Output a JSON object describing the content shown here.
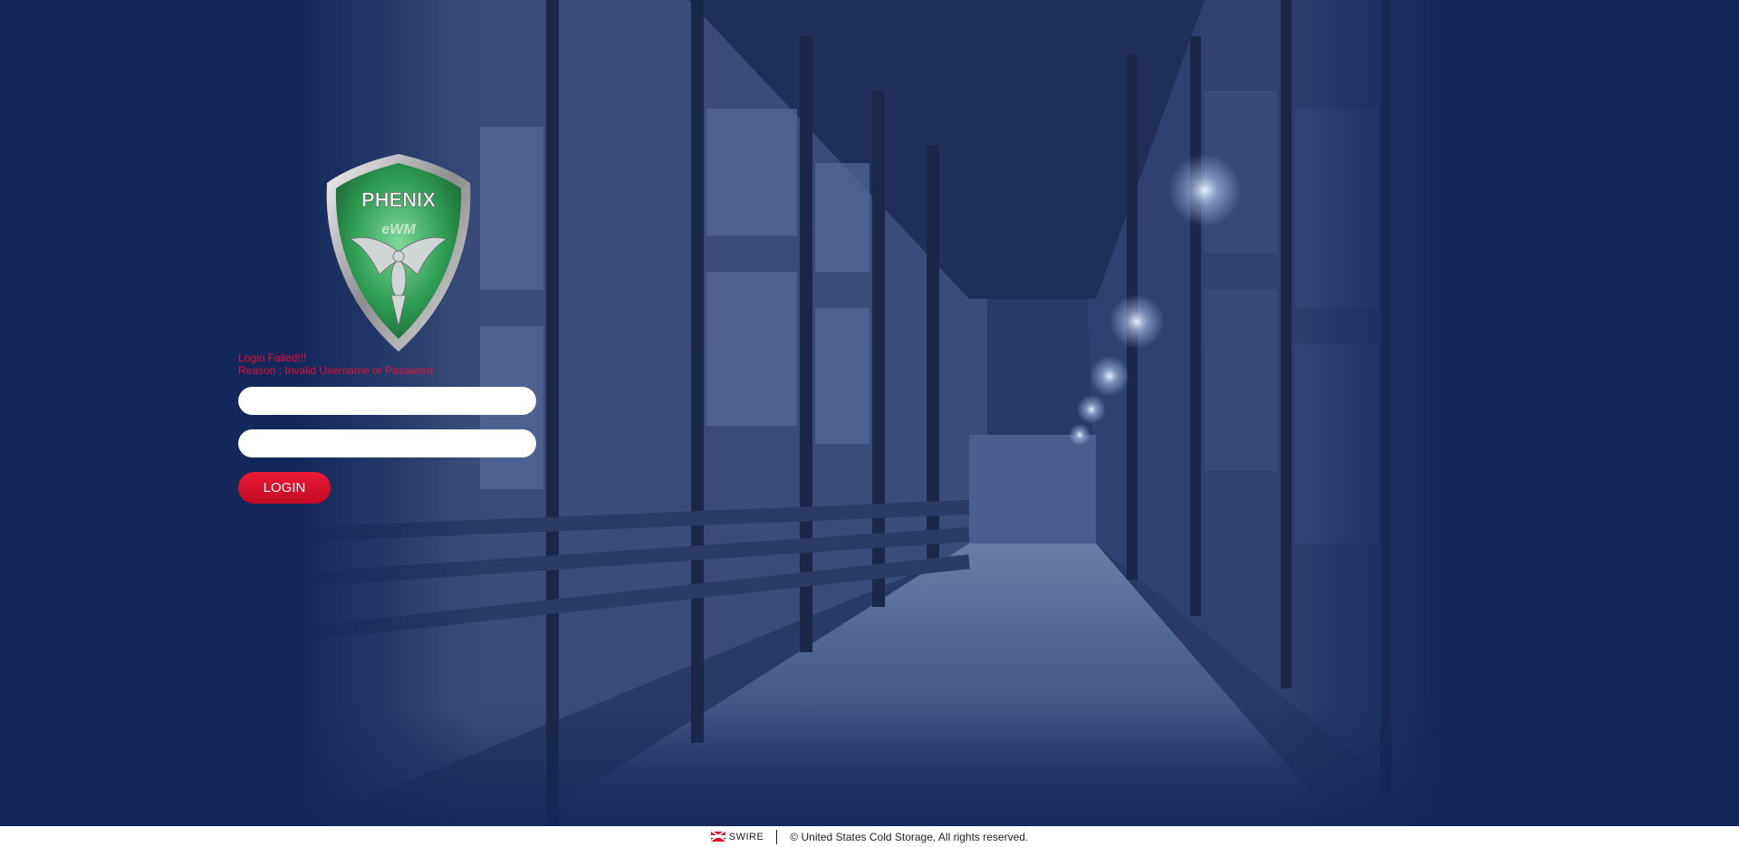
{
  "logo": {
    "brand": "PHENIX",
    "product": "eWM"
  },
  "login": {
    "error_title": "Login Failed!!!",
    "error_reason": "Reason : Invalid Username or Password",
    "username_value": "",
    "password_value": "",
    "button_label": "LOGIN"
  },
  "footer": {
    "brand": "SWIRE",
    "copyright": "© United States Cold Storage, All rights reserved."
  },
  "colors": {
    "background": "#13275a",
    "error_text": "#e8103a",
    "button": "#d8102b",
    "logo_green": "#2f9e55"
  },
  "icons": [
    "swire-flag-icon",
    "phoenix-emblem-icon"
  ]
}
